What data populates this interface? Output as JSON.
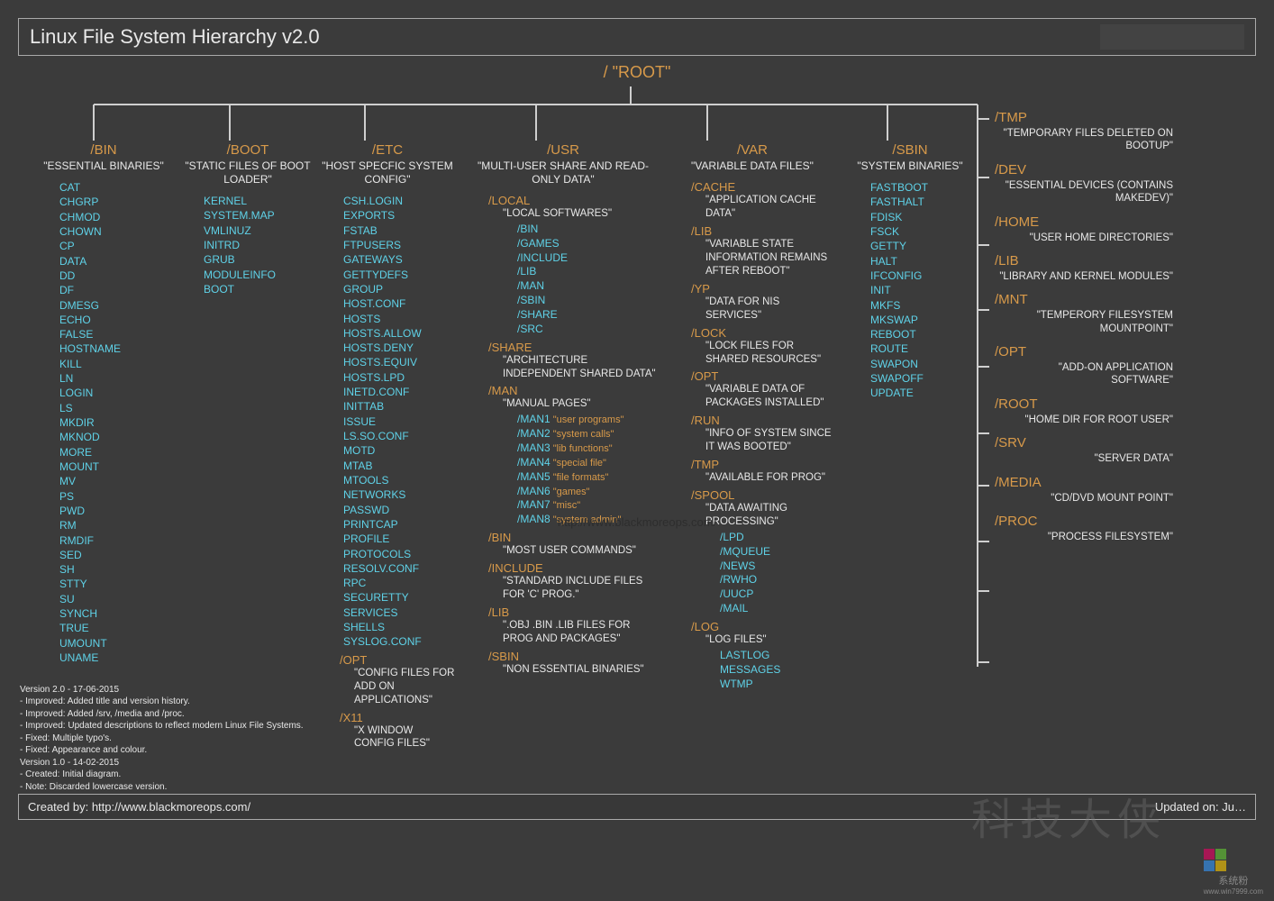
{
  "title": "Linux File System Hierarchy v2.0",
  "root_label": "/ \"ROOT\"",
  "watermark_url": "http://www.blackmoreops.com/",
  "big_watermark": "科技大侠",
  "corner_text": "系统粉",
  "corner_url": "www.win7999.com",
  "columns": {
    "bin": {
      "head": "/BIN",
      "desc": "\"ESSENTIAL BINARIES\"",
      "items": [
        "CAT",
        "CHGRP",
        "CHMOD",
        "CHOWN",
        "CP",
        "DATA",
        "DD",
        "DF",
        "DMESG",
        "ECHO",
        "FALSE",
        "HOSTNAME",
        "KILL",
        "LN",
        "LOGIN",
        "LS",
        "MKDIR",
        "MKNOD",
        "MORE",
        "MOUNT",
        "MV",
        "PS",
        "PWD",
        "RM",
        "RMDIF",
        "SED",
        "SH",
        "STTY",
        "SU",
        "SYNCH",
        "TRUE",
        "UMOUNT",
        "UNAME"
      ]
    },
    "boot": {
      "head": "/BOOT",
      "desc": "\"STATIC FILES OF BOOT LOADER\"",
      "items": [
        "KERNEL",
        "SYSTEM.MAP",
        "VMLINUZ",
        "INITRD",
        "GRUB",
        "MODULEINFO",
        "BOOT"
      ]
    },
    "etc": {
      "head": "/ETC",
      "desc": "\"HOST SPECFIC SYSTEM CONFIG\"",
      "items": [
        "CSH.LOGIN",
        "EXPORTS",
        "FSTAB",
        "FTPUSERS",
        "GATEWAYS",
        "GETTYDEFS",
        "GROUP",
        "HOST.CONF",
        "HOSTS",
        "HOSTS.ALLOW",
        "HOSTS.DENY",
        "HOSTS.EQUIV",
        "HOSTS.LPD",
        "INETD.CONF",
        "INITTAB",
        "ISSUE",
        "LS.SO.CONF",
        "MOTD",
        "MTAB",
        "MTOOLS",
        "NETWORKS",
        "PASSWD",
        "PRINTCAP",
        "PROFILE",
        "PROTOCOLS",
        "RESOLV.CONF",
        "RPC",
        "SECURETTY",
        "SERVICES",
        "SHELLS",
        "SYSLOG.CONF"
      ],
      "subs": [
        {
          "head": "/OPT",
          "desc": "\"CONFIG FILES FOR ADD ON APPLICATIONS\""
        },
        {
          "head": "/X11",
          "desc": "\"X WINDOW CONFIG FILES\""
        }
      ]
    },
    "usr": {
      "head": "/USR",
      "desc": "\"MULTI-USER SHARE AND READ-ONLY DATA\"",
      "subs": [
        {
          "head": "/LOCAL",
          "desc": "\"LOCAL SOFTWARES\"",
          "items": [
            "/BIN",
            "/GAMES",
            "/INCLUDE",
            "/LIB",
            "/MAN",
            "/SBIN",
            "/SHARE",
            "/SRC"
          ]
        },
        {
          "head": "/SHARE",
          "desc": "\"ARCHITECTURE INDEPENDENT SHARED DATA\""
        },
        {
          "head": "/MAN",
          "desc": "\"MANUAL PAGES\"",
          "man": [
            "/MAN1 \"user programs\"",
            "/MAN2 \"system calls\"",
            "/MAN3 \"lib functions\"",
            "/MAN4 \"special file\"",
            "/MAN5 \"file formats\"",
            "/MAN6 \"games\"",
            "/MAN7 \"misc\"",
            "/MAN8 \"system admin\""
          ]
        },
        {
          "head": "/BIN",
          "desc": "\"MOST USER COMMANDS\""
        },
        {
          "head": "/INCLUDE",
          "desc": "\"STANDARD INCLUDE FILES FOR 'C' PROG.\""
        },
        {
          "head": "/LIB",
          "desc": "\".OBJ .BIN .LIB FILES FOR PROG AND PACKAGES\""
        },
        {
          "head": "/SBIN",
          "desc": "\"NON ESSENTIAL BINARIES\""
        }
      ]
    },
    "var": {
      "head": "/VAR",
      "desc": "\"VARIABLE DATA FILES\"",
      "subs": [
        {
          "head": "/CACHE",
          "desc": "\"APPLICATION CACHE DATA\""
        },
        {
          "head": "/LIB",
          "desc": "\"VARIABLE STATE INFORMATION REMAINS AFTER REBOOT\""
        },
        {
          "head": "/YP",
          "desc": "\"DATA FOR NIS SERVICES\""
        },
        {
          "head": "/LOCK",
          "desc": "\"LOCK FILES FOR SHARED RESOURCES\""
        },
        {
          "head": "/OPT",
          "desc": "\"VARIABLE DATA OF PACKAGES INSTALLED\""
        },
        {
          "head": "/RUN",
          "desc": "\"INFO OF SYSTEM SINCE IT WAS BOOTED\""
        },
        {
          "head": "/TMP",
          "desc": "\"AVAILABLE FOR PROG\""
        },
        {
          "head": "/SPOOL",
          "desc": "\"DATA AWAITING PROCESSING\"",
          "items": [
            "/LPD",
            "/MQUEUE",
            "/NEWS",
            "/RWHO",
            "/UUCP",
            "/MAIL"
          ]
        },
        {
          "head": "/LOG",
          "desc": "\"LOG FILES\"",
          "items": [
            "LASTLOG",
            "MESSAGES",
            "WTMP"
          ]
        }
      ]
    },
    "sbin": {
      "head": "/SBIN",
      "desc": "\"SYSTEM BINARIES\"",
      "items": [
        "FASTBOOT",
        "FASTHALT",
        "FDISK",
        "FSCK",
        "GETTY",
        "HALT",
        "IFCONFIG",
        "INIT",
        "MKFS",
        "MKSWAP",
        "REBOOT",
        "ROUTE",
        "SWAPON",
        "SWAPOFF",
        "UPDATE"
      ]
    }
  },
  "right": [
    {
      "head": "/TMP",
      "desc": "\"TEMPORARY FILES DELETED ON BOOTUP\""
    },
    {
      "head": "/DEV",
      "desc": "\"ESSENTIAL DEVICES (CONTAINS MAKEDEV)\""
    },
    {
      "head": "/HOME",
      "desc": "\"USER HOME DIRECTORIES\""
    },
    {
      "head": "/LIB",
      "desc": "\"LIBRARY AND KERNEL MODULES\""
    },
    {
      "head": "/MNT",
      "desc": "\"TEMPERORY FILESYSTEM MOUNTPOINT\""
    },
    {
      "head": "/OPT",
      "desc": "\"ADD-ON APPLICATION SOFTWARE\""
    },
    {
      "head": "/ROOT",
      "desc": "\"HOME DIR FOR ROOT USER\""
    },
    {
      "head": "/SRV",
      "desc": "\"SERVER DATA\""
    },
    {
      "head": "/MEDIA",
      "desc": "\"CD/DVD MOUNT POINT\""
    },
    {
      "head": "/PROC",
      "desc": "\"PROCESS FILESYSTEM\""
    }
  ],
  "changelog": [
    "Version 2.0 - 17-06-2015",
    "- Improved: Added title and version history.",
    "- Improved: Added /srv, /media and /proc.",
    "- Improved: Updated descriptions to reflect modern Linux File Systems.",
    "- Fixed: Multiple typo's.",
    "- Fixed: Appearance and colour.",
    "Version 1.0 - 14-02-2015",
    "- Created: Initial diagram.",
    "- Note: Discarded lowercase version."
  ],
  "footer": {
    "left": "Created by: http://www.blackmoreops.com/",
    "right": "Updated on: Ju…"
  }
}
